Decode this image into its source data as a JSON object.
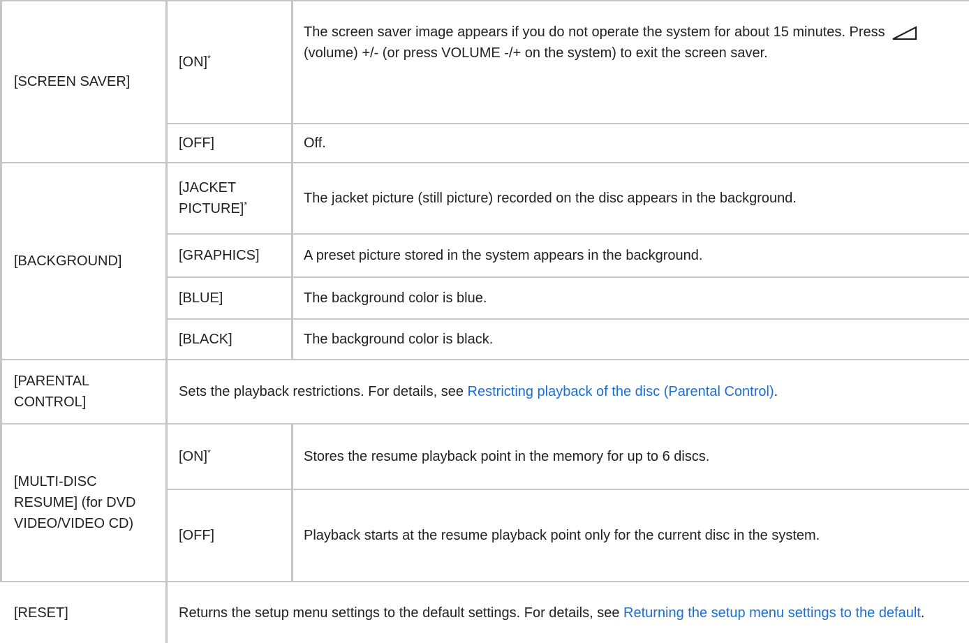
{
  "rows": {
    "screen_saver": {
      "label": "[SCREEN SAVER]",
      "options": [
        {
          "name": "[ON]",
          "star": "*",
          "desc_a": "The screen saver image appears if you do not operate the system for about 15 minutes. Press",
          "desc_b": "(volume) +/- (or press VOLUME -/+ on the system) to exit the screen saver."
        },
        {
          "name": "[OFF]",
          "desc": "Off."
        }
      ]
    },
    "background": {
      "label": "[BACKGROUND]",
      "options": [
        {
          "name": "[JACKET PICTURE]",
          "star": "*",
          "desc": "The jacket picture (still picture) recorded on the disc appears in the background."
        },
        {
          "name": "[GRAPHICS]",
          "desc": "A preset picture stored in the system appears in the background."
        },
        {
          "name": "[BLUE]",
          "desc": "The background color is blue."
        },
        {
          "name": "[BLACK]",
          "desc": "The background color is black."
        }
      ]
    },
    "parental": {
      "label": "[PARENTAL CONTROL]",
      "desc": "Sets the playback restrictions. For details, see",
      "link": "Restricting playback of the disc (Parental Control)",
      "tail": "."
    },
    "multi_disc": {
      "label": "[MULTI-DISC RESUME] (for DVD VIDEO/VIDEO CD)",
      "options": [
        {
          "name": "[ON]",
          "star": "*",
          "desc": "Stores the resume playback point in the memory for up to 6 discs."
        },
        {
          "name": "[OFF]",
          "desc": "Playback starts at the resume playback point only for the current disc in the system."
        }
      ]
    },
    "reset": {
      "label": "[RESET]",
      "desc": "Returns the setup menu settings to the default settings. For details, see",
      "link": "Returning the setup menu settings to the default",
      "tail": "."
    }
  },
  "icons": {
    "volume": "volume-triangle-icon"
  },
  "colors": {
    "link": "#1a6fd4",
    "rule": "#c6c6c6",
    "text": "#222222"
  }
}
